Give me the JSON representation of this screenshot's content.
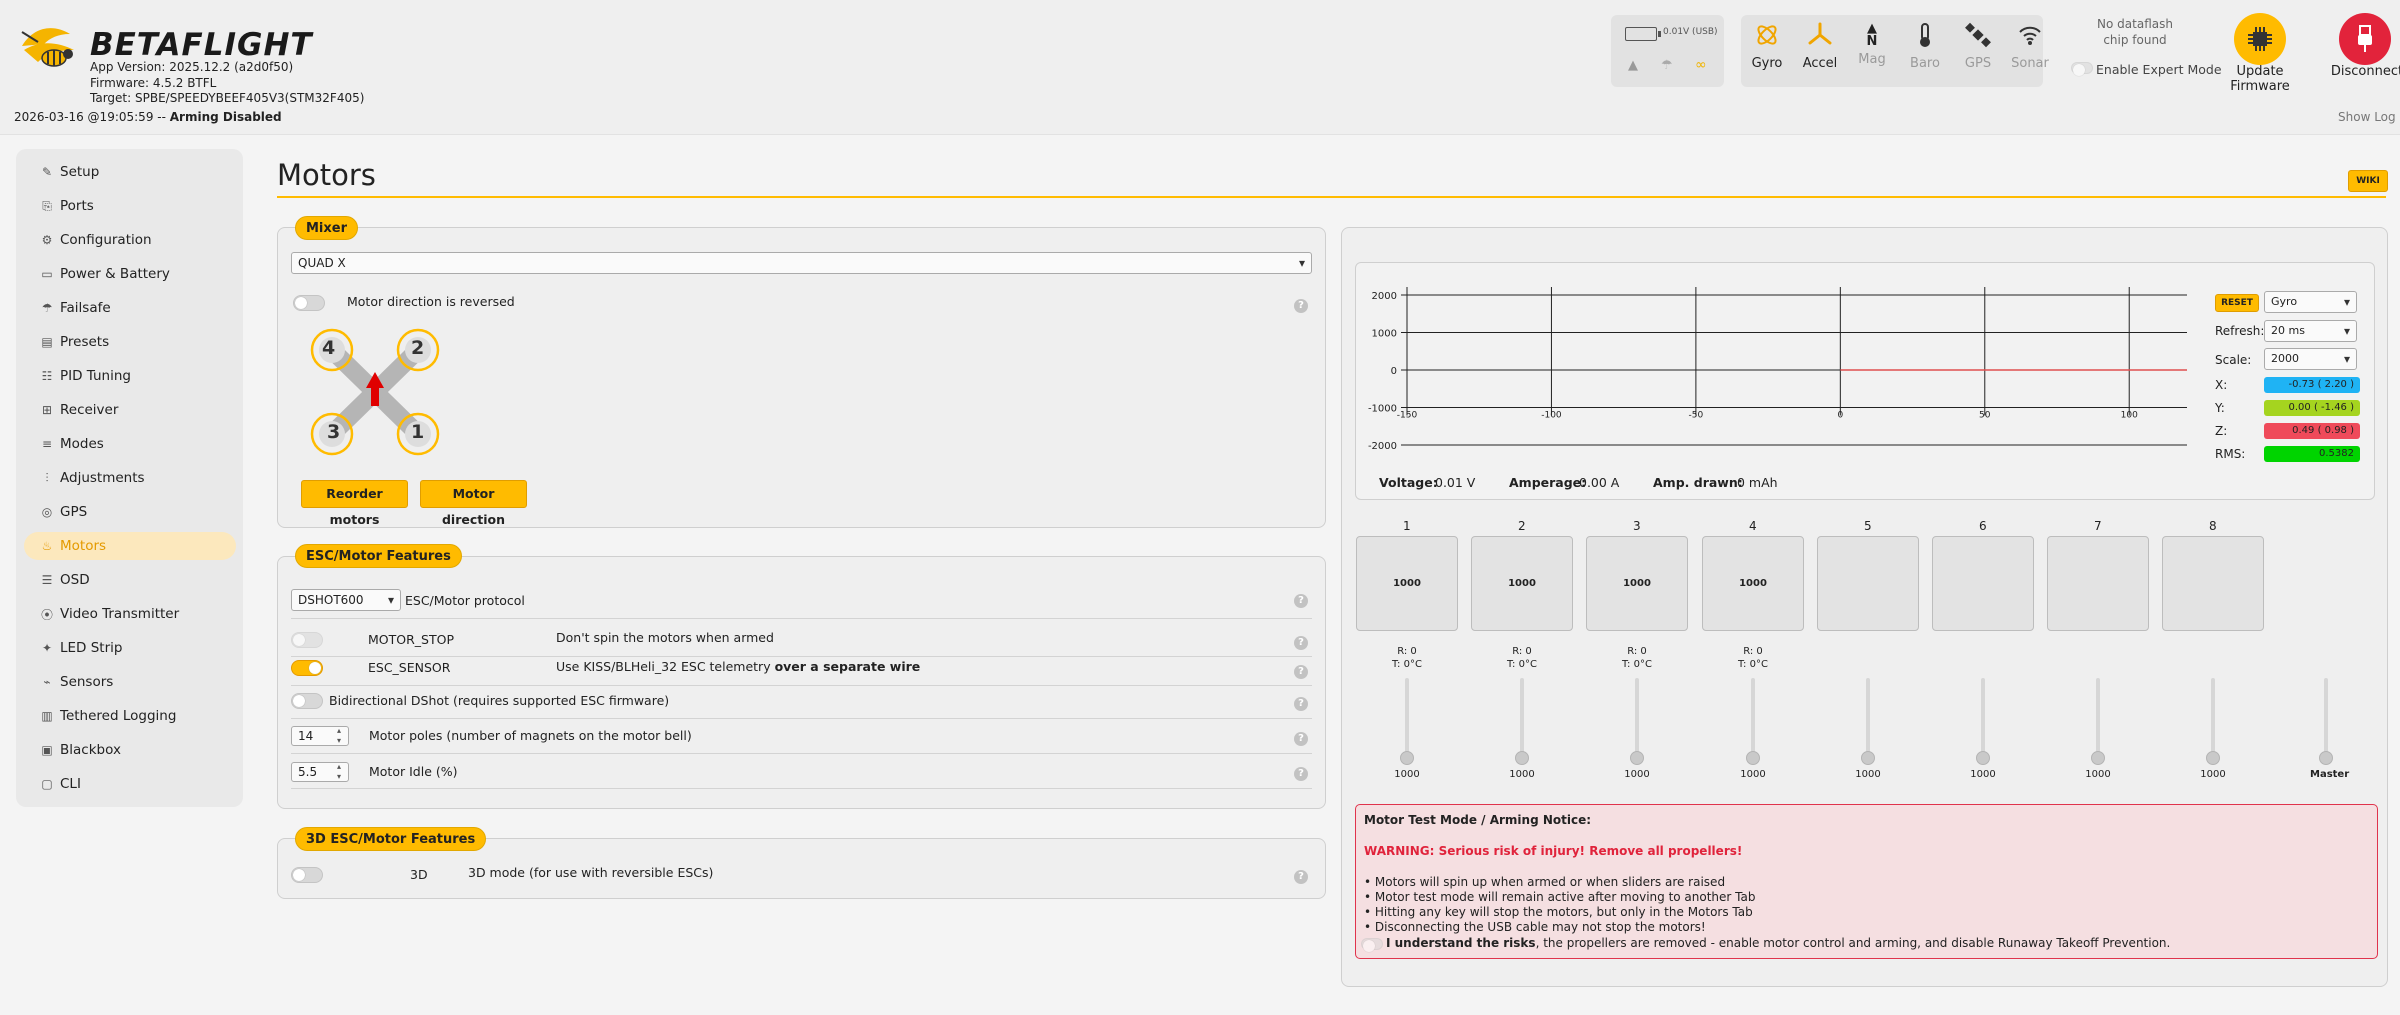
{
  "app": {
    "brand": "BETAFLIGHT",
    "app_version": "App Version: 2025.12.2 (a2d0f50)",
    "firmware": "Firmware: 4.5.2 BTFL",
    "target": "Target: SPBE/SPEEDYBEEF405V3(STM32F405)",
    "status_datetime": "2026-03-16 @19:05:59 -- ",
    "status_state": "Arming Disabled",
    "show_log": "Show Log",
    "battery_voltage": "0.01V (USB)"
  },
  "sensors": [
    {
      "name": "Gyro",
      "icon": "gyro-icon",
      "active": true
    },
    {
      "name": "Accel",
      "icon": "accel-icon",
      "active": true
    },
    {
      "name": "Mag",
      "icon": "compass-icon",
      "active": false
    },
    {
      "name": "Baro",
      "icon": "thermometer-icon",
      "active": false
    },
    {
      "name": "GPS",
      "icon": "satellite-icon",
      "active": false
    },
    {
      "name": "Sonar",
      "icon": "wifi-icon",
      "active": false
    }
  ],
  "header": {
    "dataflash_line1": "No dataflash",
    "dataflash_line2": "chip found",
    "expert_mode": "Enable Expert Mode",
    "update_firmware": "Update Firmware",
    "disconnect": "Disconnect",
    "mag_letter": "N"
  },
  "sidebar": {
    "items": [
      {
        "label": "Setup",
        "icon": "wrench-icon"
      },
      {
        "label": "Ports",
        "icon": "plug-icon"
      },
      {
        "label": "Configuration",
        "icon": "gear-icon"
      },
      {
        "label": "Power & Battery",
        "icon": "battery-icon"
      },
      {
        "label": "Failsafe",
        "icon": "parachute-icon"
      },
      {
        "label": "Presets",
        "icon": "presets-icon"
      },
      {
        "label": "PID Tuning",
        "icon": "pid-icon"
      },
      {
        "label": "Receiver",
        "icon": "receiver-icon"
      },
      {
        "label": "Modes",
        "icon": "modes-icon"
      },
      {
        "label": "Adjustments",
        "icon": "sliders-icon"
      },
      {
        "label": "GPS",
        "icon": "gps-icon"
      },
      {
        "label": "Motors",
        "icon": "flame-icon",
        "active": true
      },
      {
        "label": "OSD",
        "icon": "osd-icon"
      },
      {
        "label": "Video Transmitter",
        "icon": "antenna-icon"
      },
      {
        "label": "LED Strip",
        "icon": "led-icon"
      },
      {
        "label": "Sensors",
        "icon": "sensors-icon"
      },
      {
        "label": "Tethered Logging",
        "icon": "tether-icon"
      },
      {
        "label": "Blackbox",
        "icon": "blackbox-icon"
      },
      {
        "label": "CLI",
        "icon": "cli-icon"
      }
    ]
  },
  "page": {
    "title": "Motors",
    "wiki": "WIKI"
  },
  "mixer": {
    "legend": "Mixer",
    "selected": "QUAD X",
    "direction_label": "Motor direction is reversed",
    "reorder": "Reorder motors",
    "direction": "Motor direction",
    "motor_numbers": [
      "4",
      "2",
      "3",
      "1"
    ]
  },
  "esc": {
    "legend": "ESC/Motor Features",
    "protocol": "DSHOT600",
    "protocol_label": "ESC/Motor protocol",
    "motor_stop": "MOTOR_STOP",
    "motor_stop_desc": "Don't spin the motors when armed",
    "esc_sensor": "ESC_SENSOR",
    "esc_sensor_desc": "Use KISS/BLHeli_32 ESC telemetry ",
    "esc_sensor_desc_bold": "over a separate wire",
    "bidir": "Bidirectional DShot (requires supported ESC firmware)",
    "poles_value": "14",
    "poles_label": "Motor poles (number of magnets on the motor bell)",
    "idle_value": "5.5",
    "idle_label": "Motor Idle (%)"
  },
  "esc3d": {
    "legend": "3D ESC/Motor Features",
    "name": "3D",
    "desc": "3D mode (for use with reversible ESCs)"
  },
  "graph": {
    "reset": "RESET",
    "source": "Gyro",
    "refresh_label": "Refresh:",
    "refresh": "20 ms",
    "scale_label": "Scale:",
    "scale": "2000",
    "x_label": "X:",
    "x_val": "-0.73 ( 2.20 )",
    "y_label": "Y:",
    "y_val": "0.00 ( -1.46 )",
    "z_label": "Z:",
    "z_val": "0.49 ( 0.98 )",
    "rms_label": "RMS:",
    "rms_val": "0.5382",
    "colors": {
      "x": "#1fb3f4",
      "y": "#a5d41f",
      "z": "#ef4a5a",
      "rms": "#00d400"
    },
    "voltage_label": "Voltage:",
    "voltage": "0.01 V",
    "amperage_label": "Amperage:",
    "amperage": "0.00 A",
    "drawn_label": "Amp. drawn:",
    "drawn": "0 mAh"
  },
  "chart_data": {
    "type": "line",
    "title": "",
    "xlabel": "",
    "ylabel": "",
    "x_ticks": [
      "-150",
      "-100",
      "-50",
      "0",
      "50",
      "100"
    ],
    "y_ticks": [
      "2000",
      "1000",
      "0",
      "-1000",
      "-2000"
    ],
    "ylim": [
      -2000,
      2000
    ],
    "xlim": [
      -150,
      120
    ],
    "series": [
      {
        "color": "#e05050",
        "x": [
          0,
          120
        ],
        "values": [
          0,
          0
        ]
      }
    ]
  },
  "motors": {
    "boxes": [
      {
        "num": "1",
        "value": "1000",
        "telemetry": true
      },
      {
        "num": "2",
        "value": "1000",
        "telemetry": true
      },
      {
        "num": "3",
        "value": "1000",
        "telemetry": true
      },
      {
        "num": "4",
        "value": "1000",
        "telemetry": true
      },
      {
        "num": "5",
        "value": "",
        "telemetry": false
      },
      {
        "num": "6",
        "value": "",
        "telemetry": false
      },
      {
        "num": "7",
        "value": "",
        "telemetry": false
      },
      {
        "num": "8",
        "value": "",
        "telemetry": false
      }
    ],
    "rpm": "R: 0",
    "temp": "T: 0°C",
    "slider_values": [
      "1000",
      "1000",
      "1000",
      "1000",
      "1000",
      "1000",
      "1000",
      "1000"
    ],
    "master": "Master"
  },
  "notice": {
    "title": "Motor Test Mode / Arming Notice:",
    "warning": "WARNING: Serious risk of injury! Remove all propellers!",
    "bullets": [
      "• Motors will spin up when armed or when sliders are raised",
      "• Motor test mode will remain active after moving to another Tab",
      "• Hitting any key will stop the motors, but only in the Motors Tab",
      "• Disconnecting the USB cable may not stop the motors!"
    ],
    "understand_bold": "I understand the risks",
    "understand_rest": ", the propellers are removed - enable motor control and arming, and disable Runaway Takeoff Prevention."
  }
}
